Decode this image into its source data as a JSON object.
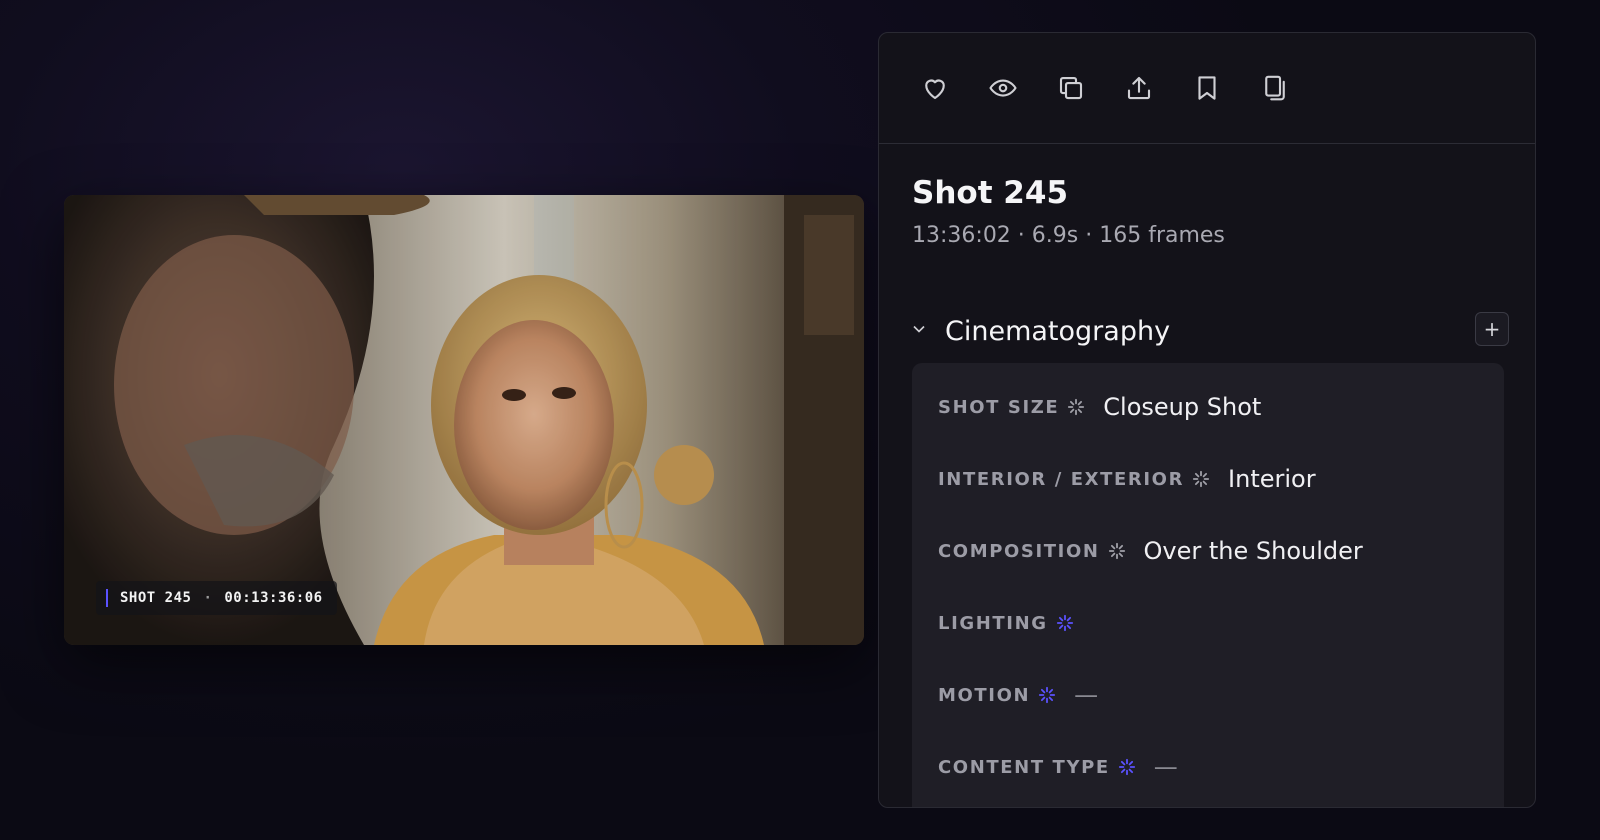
{
  "preview": {
    "badge_shot": "SHOT 245",
    "badge_separator": "·",
    "badge_timecode": "00:13:36:06"
  },
  "toolbar": {
    "icons": [
      "heart-icon",
      "eye-icon",
      "duplicate-icon",
      "upload-icon",
      "bookmark-icon",
      "copy-icon"
    ]
  },
  "shot": {
    "title": "Shot 245",
    "meta": "13:36:02 · 6.9s · 165 frames"
  },
  "section": {
    "title": "Cinematography",
    "add_label": "+",
    "rows": [
      {
        "label": "SHOT SIZE",
        "value": "Closeup Shot",
        "ai_state": "filled"
      },
      {
        "label": "INTERIOR / EXTERIOR",
        "value": "Interior",
        "ai_state": "filled"
      },
      {
        "label": "COMPOSITION",
        "value": "Over the Shoulder",
        "ai_state": "filled"
      },
      {
        "label": "LIGHTING",
        "value": "",
        "ai_state": "active"
      },
      {
        "label": "MOTION",
        "value": "—",
        "ai_state": "active"
      },
      {
        "label": "CONTENT TYPE",
        "value": "—",
        "ai_state": "active"
      }
    ]
  },
  "colors": {
    "accent": "#5b52ff",
    "spark_filled": "#a0a0a8",
    "spark_active": "#5b52ff"
  }
}
